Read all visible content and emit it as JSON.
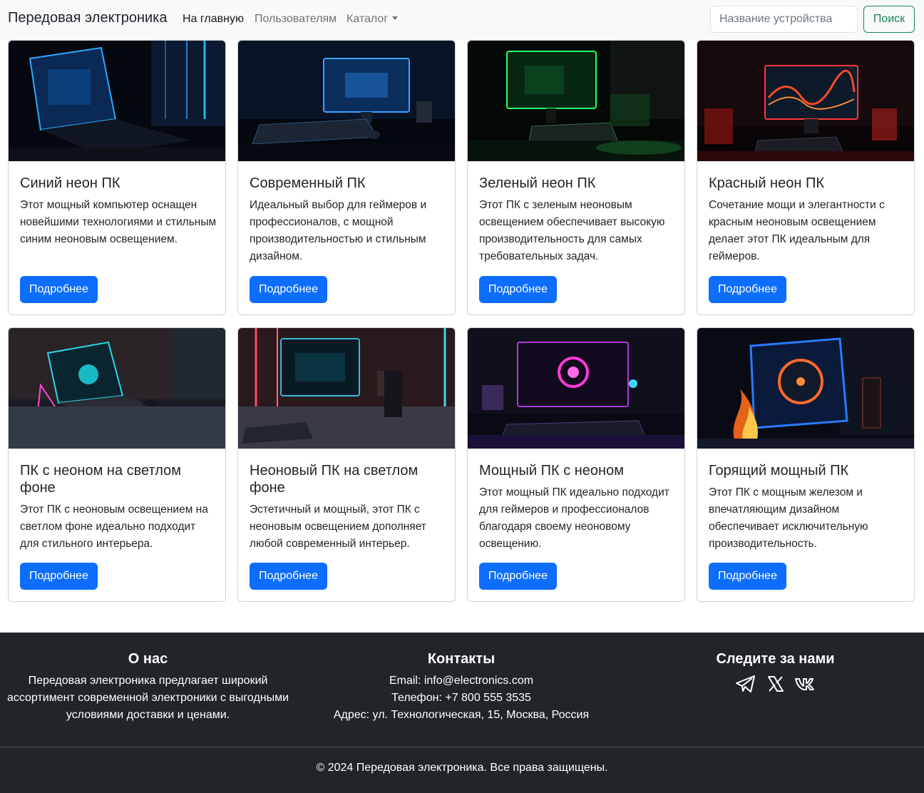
{
  "navbar": {
    "brand": "Передовая электроника",
    "links": [
      "На главную",
      "Пользователям",
      "Каталог"
    ],
    "search_placeholder": "Название устройства",
    "search_button": "Поиск"
  },
  "cards": [
    {
      "title": "Синий неон ПК",
      "text": "Этот мощный компьютер оснащен новейшими технологиями и стильным синим неоновым освещением.",
      "button": "Подробнее"
    },
    {
      "title": "Современный ПК",
      "text": "Идеальный выбор для геймеров и профессионалов, с мощной производительностью и стильным дизайном.",
      "button": "Подробнее"
    },
    {
      "title": "Зеленый неон ПК",
      "text": "Этот ПК с зеленым неоновым освещением обеспечивает высокую производительность для самых требовательных задач.",
      "button": "Подробнее"
    },
    {
      "title": "Красный неон ПК",
      "text": "Сочетание мощи и элегантности с красным неоновым освещением делает этот ПК идеальным для геймеров.",
      "button": "Подробнее"
    },
    {
      "title": "ПК с неоном на светлом фоне",
      "text": "Этот ПК с неоновым освещением на светлом фоне идеально подходит для стильного интерьера.",
      "button": "Подробнее"
    },
    {
      "title": "Неоновый ПК на светлом фоне",
      "text": "Эстетичный и мощный, этот ПК с неоновым освещением дополняет любой современный интерьер.",
      "button": "Подробнее"
    },
    {
      "title": "Мощный ПК с неоном",
      "text": "Этот мощный ПК идеально подходит для геймеров и профессионалов благодаря своему неоновому освещению.",
      "button": "Подробнее"
    },
    {
      "title": "Горящий мощный ПК",
      "text": "Этот ПК с мощным железом и впечатляющим дизайном обеспечивает исключительную производительность.",
      "button": "Подробнее"
    }
  ],
  "footer": {
    "about_title": "О нас",
    "about_lines": [
      "Передовая электроника предлагает широкий",
      "ассортимент современной электроники с выгодными",
      "условиями доставки и ценами."
    ],
    "contacts_title": "Контакты",
    "contacts_lines": [
      "Email: info@electronics.com",
      "Телефон: +7 800 555 3535",
      "Адрес: ул. Технологическая, 15, Москва, Россия"
    ],
    "follow_title": "Следите за нами",
    "social_icons": [
      "telegram-icon",
      "x-icon",
      "vk-icon"
    ],
    "copyright": "© 2024 Передовая электроника. Все права защищены."
  }
}
